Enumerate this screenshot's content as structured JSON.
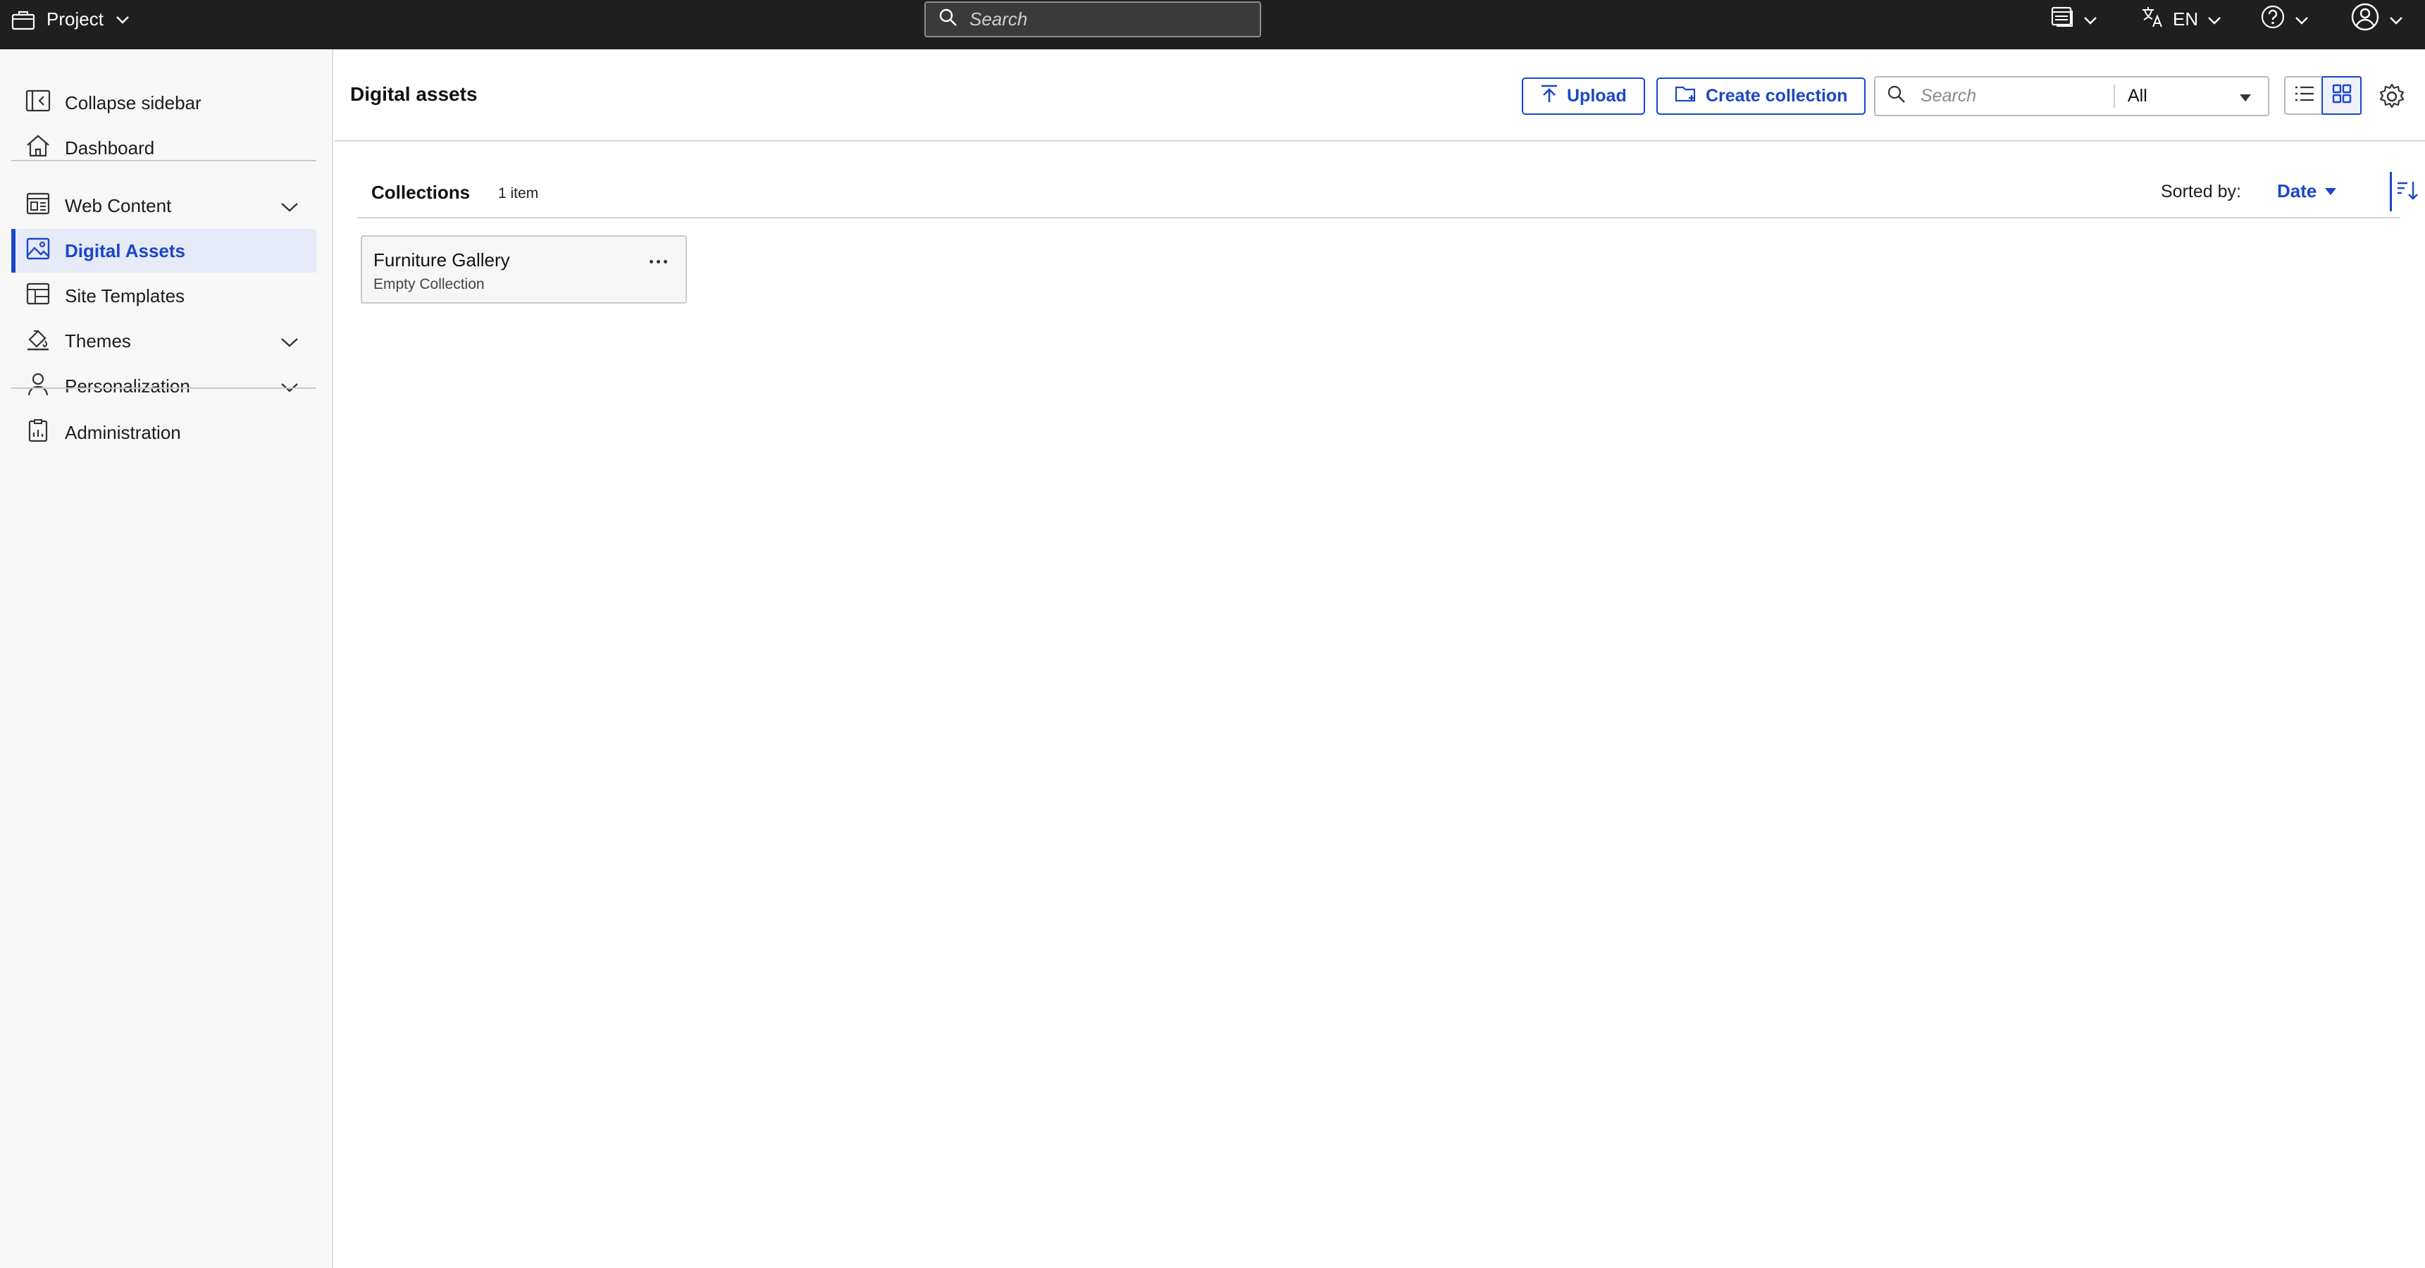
{
  "topbar": {
    "project_label": "Project",
    "search_placeholder": "Search",
    "language": "EN",
    "icons": [
      "briefcase-icon",
      "search-icon",
      "site-icon",
      "translate-icon",
      "help-icon",
      "user-icon"
    ]
  },
  "sidebar": {
    "items": [
      {
        "label": "Collapse sidebar",
        "icon": "collapse-sidebar-icon"
      },
      {
        "label": "Dashboard",
        "icon": "home-icon"
      },
      {
        "label": "Web Content",
        "icon": "web-content-icon",
        "expandable": true
      },
      {
        "label": "Digital Assets",
        "icon": "image-icon",
        "active": true
      },
      {
        "label": "Site Templates",
        "icon": "template-icon"
      },
      {
        "label": "Themes",
        "icon": "paint-icon",
        "expandable": true
      },
      {
        "label": "Personalization",
        "icon": "person-icon",
        "expandable": true
      },
      {
        "label": "Administration",
        "icon": "clipboard-icon"
      }
    ]
  },
  "header": {
    "title": "Digital assets",
    "upload_label": "Upload",
    "create_collection_label": "Create collection",
    "search_placeholder": "Search",
    "filter_value": "All",
    "view_mode": "grid"
  },
  "collections": {
    "title": "Collections",
    "count": "1 item",
    "sorted_label": "Sorted by:",
    "sorted_value": "Date",
    "items": [
      {
        "name": "Furniture Gallery",
        "subtitle": "Empty Collection"
      }
    ]
  },
  "colors": {
    "accent": "#1a47c8",
    "topbar_bg": "#1f1f1f",
    "sidebar_bg": "#f7f7f7",
    "active_bg": "#e7eaf7"
  }
}
